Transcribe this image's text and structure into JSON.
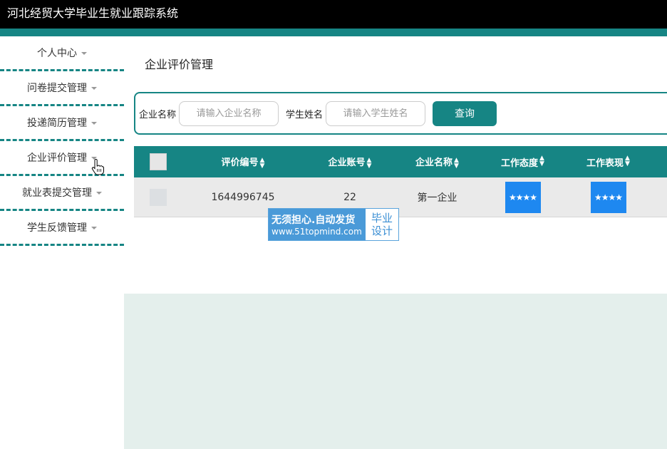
{
  "app": {
    "title": "河北经贸大学毕业生就业跟踪系统"
  },
  "sidebar": {
    "items": [
      {
        "label": "个人中心"
      },
      {
        "label": "问卷提交管理"
      },
      {
        "label": "投递简历管理"
      },
      {
        "label": "企业评价管理"
      },
      {
        "label": "就业表提交管理"
      },
      {
        "label": "学生反馈管理"
      }
    ]
  },
  "main": {
    "title": "企业评价管理",
    "search": {
      "company_label": "企业名称",
      "company_placeholder": "请输入企业名称",
      "student_label": "学生姓名",
      "student_placeholder": "请输入学生姓名",
      "query_label": "查询"
    },
    "table": {
      "headers": [
        "评价编号",
        "企业账号",
        "企业名称",
        "工作态度",
        "工作表现"
      ],
      "rows": [
        {
          "id": "1644996745",
          "account": "22",
          "name": "第一企业",
          "attitude": "★★★★",
          "performance": "★★★★"
        }
      ]
    }
  },
  "watermark": {
    "line1": "无须担心.自动发货",
    "line2": "www.51topmind.com",
    "right1": "毕业",
    "right2": "设计"
  },
  "colors": {
    "accent": "#168584",
    "star_bg": "#1e88f0",
    "topbar": "#000000"
  },
  "icons": {
    "caret": "caret-down-icon",
    "cursor": "hand-cursor-icon",
    "sort": "sort-icon"
  }
}
